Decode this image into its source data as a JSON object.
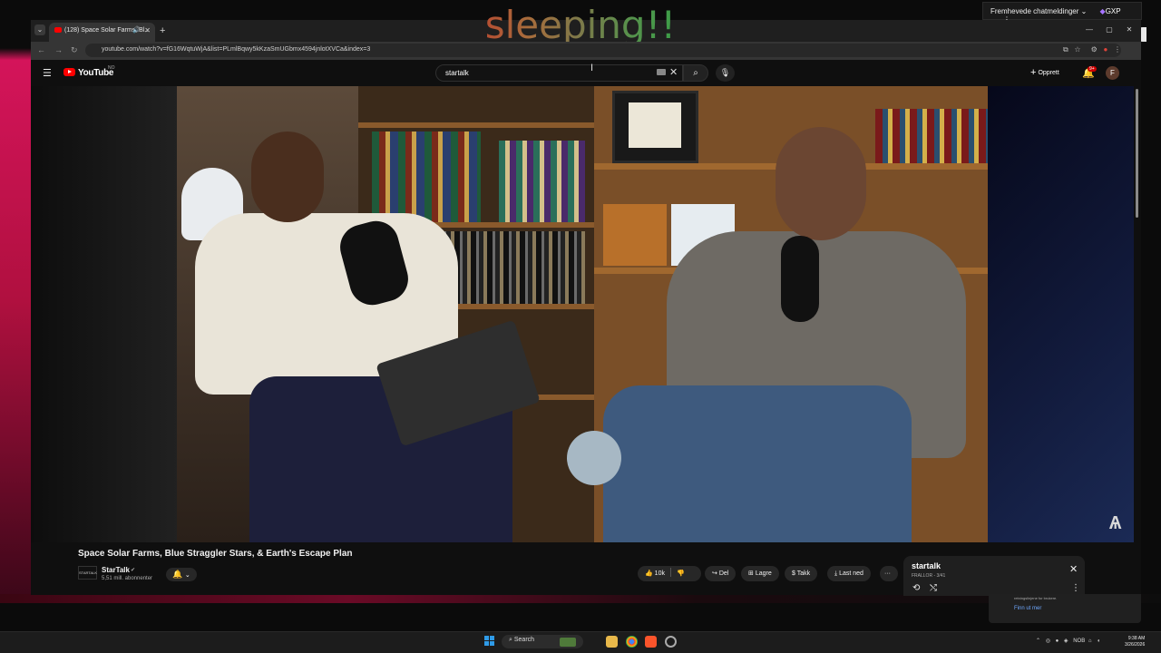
{
  "overlay": {
    "text": "sleeping!!"
  },
  "chat_pill": {
    "label": "Fremhevede chatmeldinger",
    "gxp_label": "GXP"
  },
  "browser": {
    "tab_title": "(128) Space Solar Farms, Bl...",
    "url": "youtube.com/watch?v=fG16WqtuWjA&list=PLmlBqwy5kKzaSmUGbmx4594jnlotXVCa&index=3"
  },
  "youtube": {
    "logo_text": "YouTube",
    "region": "NO",
    "search_value": "startalk",
    "create_label": "Opprett",
    "notif_badge": "9+",
    "avatar_letter": "F"
  },
  "video": {
    "title": "Space Solar Farms, Blue Straggler Stars, & Earth's Escape Plan",
    "channel_name": "StarTalk",
    "channel_logo_text": "STARTALK",
    "subscribers": "5,51 mill. abonnenter",
    "likes": "10k",
    "share_label": "Del",
    "save_label": "Lagre",
    "thanks_label": "Takk",
    "download_label": "Last ned"
  },
  "playlist": {
    "title": "startalk",
    "subtitle": "FRALLOR - 3/41"
  },
  "bg_notification": {
    "text": "retningslinjene for brukere.",
    "link": "Finn ut mer"
  },
  "taskbar": {
    "search_label": "Search",
    "tray_lang": "NOB",
    "time": "9:38 AM",
    "date": "3/26/2026"
  },
  "colors": {
    "youtube_red": "#ff0000",
    "accent_blue": "#3ea6ff"
  }
}
